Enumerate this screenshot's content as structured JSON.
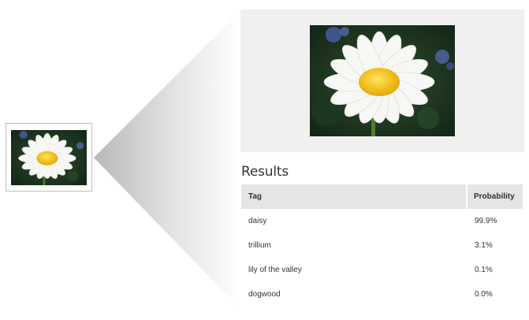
{
  "thumbnail": {
    "icon": "daisy-photo"
  },
  "preview": {
    "icon": "daisy-photo"
  },
  "results": {
    "title": "Results",
    "columns": [
      "Tag",
      "Probability"
    ],
    "rows": [
      {
        "tag": "daisy",
        "probability": "99.9%"
      },
      {
        "tag": "trillium",
        "probability": "3.1%"
      },
      {
        "tag": "lily of the valley",
        "probability": "0.1%"
      },
      {
        "tag": "dogwood",
        "probability": "0.0%"
      }
    ]
  },
  "colors": {
    "header_bg": "#e5e5e5",
    "panel_bg": "#f0f0f0",
    "daisy_center": "#f2c200",
    "petal": "#f7f7f5",
    "foliage": "#1f3a1f"
  }
}
